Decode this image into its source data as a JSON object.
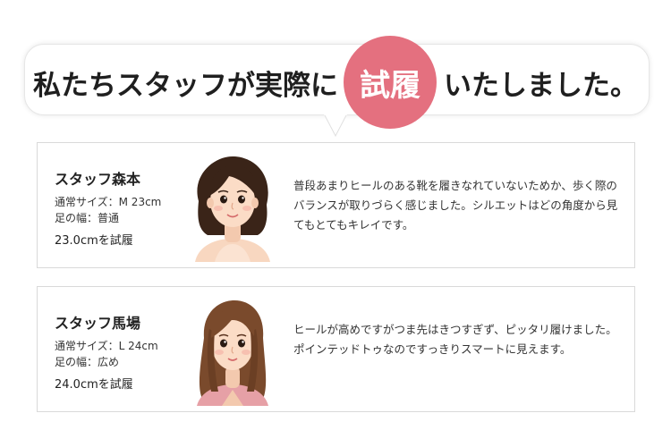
{
  "header": {
    "lead": "私たちスタッフが実際に",
    "highlight": "試履",
    "tail": "いたしました。",
    "accent_color": "#e4707f"
  },
  "staff": [
    {
      "name": "スタッフ森本",
      "size": "通常サイズ：M 23cm",
      "width": "足の幅：普通",
      "tried": "23.0cmを試履",
      "comment": "普段あまりヒールのある靴を履きなれていないためか、歩く際のバランスが取りづらく感じました。シルエットはどの角度から見てもとてもキレイです。",
      "avatar_icon": "woman-short-dark-hair-avatar"
    },
    {
      "name": "スタッフ馬場",
      "size": "通常サイズ：L 24cm",
      "width": "足の幅：広め",
      "tried": "24.0cmを試履",
      "comment": "ヒールが高めですがつま先はきつすぎず、ピッタリ履けました。ポインテッドトゥなのですっきりスマートに見えます。",
      "avatar_icon": "woman-long-brown-hair-avatar"
    }
  ]
}
